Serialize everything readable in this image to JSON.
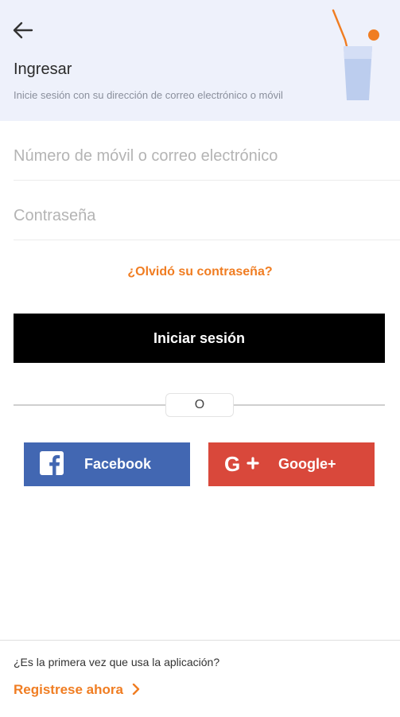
{
  "header": {
    "title": "Ingresar",
    "subtitle": "Inicie sesión con su dirección de correo electrónico o móvil"
  },
  "form": {
    "user_placeholder": "Número de móvil o correo electrónico",
    "password_placeholder": "Contraseña",
    "forgot_label": "¿Olvidó su contraseña?",
    "login_label": "Iniciar sesión",
    "divider_label": "O"
  },
  "social": {
    "facebook_label": "Facebook",
    "google_label": "Google+"
  },
  "footer": {
    "question": "¿Es la primera vez que usa la aplicación?",
    "register_label": "Registrese ahora"
  },
  "colors": {
    "accent": "#f07d22",
    "facebook": "#4267b2",
    "google": "#d9483b",
    "header_bg": "#eef1fb"
  }
}
